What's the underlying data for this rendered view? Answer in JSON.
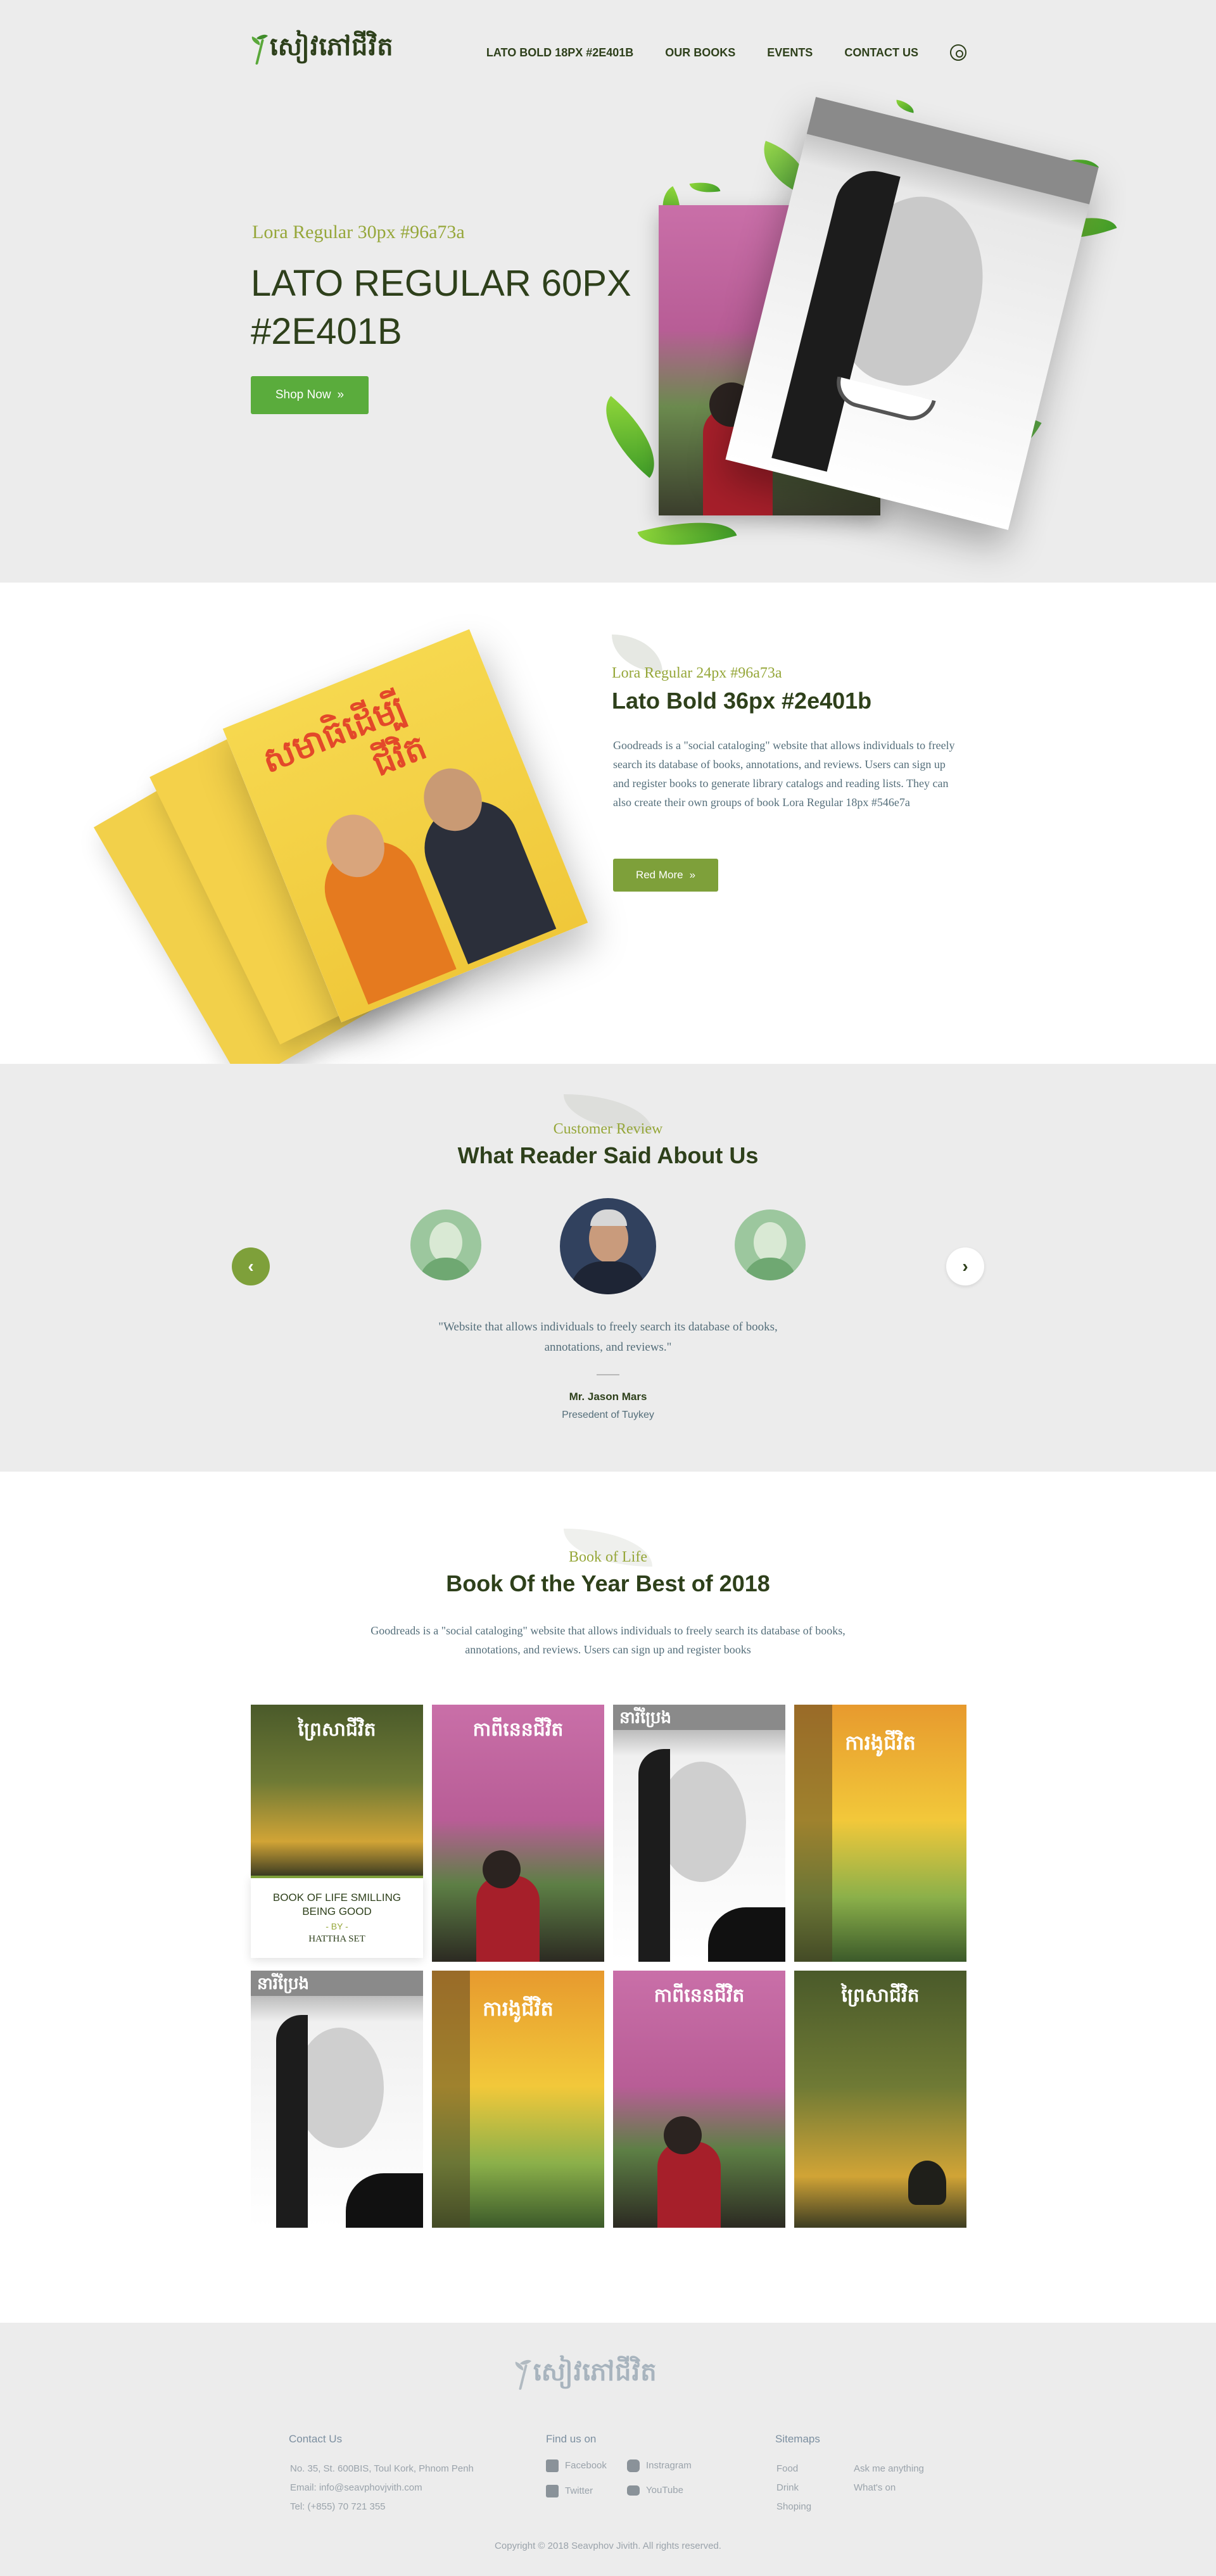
{
  "brand": {
    "logo_text": "សៀវភៅជីវិត"
  },
  "nav": {
    "items": [
      "LATO BOLD 18PX #2E401B",
      "OUR BOOKS",
      "EVENTS",
      "CONTACT US"
    ]
  },
  "hero": {
    "subtitle": "Lora Regular 30px #96a73a",
    "title": "LATO REGULAR 60PX #2E401B",
    "button": "Shop Now"
  },
  "about": {
    "subtitle": "Lora Regular 24px #96a73a",
    "title": "Lato Bold 36px #2e401b",
    "text": "Goodreads is a \"social cataloging\" website that allows individuals to freely search its database of books, annotations, and reviews. Users can sign up and register books to generate library catalogs and reading lists. They can also create their own groups of book Lora Regular 18px #546e7a",
    "button": "Red More",
    "book_title_line1": "សមាធិដើម្បី",
    "book_title_line2": "ជីវិត"
  },
  "review": {
    "subtitle": "Customer Review",
    "title": "What Reader Said About Us",
    "quote": "\"Website that allows individuals to freely search its database of books, annotations, and reviews.\"",
    "name": "Mr. Jason Mars",
    "role": "Presedent of Tuykey"
  },
  "books": {
    "subtitle": "Book of Life",
    "title": "Book Of the Year Best of 2018",
    "text": "Goodreads is a \"social cataloging\" website that allows individuals to freely search its database of books, annotations, and reviews. Users can sign up and register books",
    "featured": {
      "line1": "BOOK OF LIFE SMILLING",
      "line2": "BEING GOOD",
      "by": "- BY -",
      "author": "HATTHA SET"
    },
    "covers": [
      "ព្រៃសាជីវិត",
      "កាពីនេនជីវិត",
      "នារីប្រែង",
      "ការងូជីវិត",
      "នារីប្រែង",
      "ការងូជីវិត",
      "កាពីនេនជីវិត",
      "ព្រៃសាជីវិត"
    ]
  },
  "footer": {
    "contact_head": "Contact Us",
    "contact_lines": [
      "No. 35, St. 600BIS, Toul Kork, Phnom Penh",
      "Email: info@seavphovjvith.com",
      "Tel: (+855) 70 721 355"
    ],
    "find_head": "Find us on",
    "social": [
      "Facebook",
      "Instragram",
      "Twitter",
      "YouTube"
    ],
    "sitemap_head": "Sitemaps",
    "sitemap_col1": [
      "Food",
      "Drink",
      "Shoping"
    ],
    "sitemap_col2": [
      "Ask me anything",
      "What's on"
    ],
    "copyright": "Copyright © 2018 Seavphov Jivith.  All rights reserved."
  },
  "colors": {
    "primary": "#2e401b",
    "accent": "#96a73a",
    "green_button": "#5aac3c",
    "text": "#546e7a",
    "background": "#ececec"
  }
}
